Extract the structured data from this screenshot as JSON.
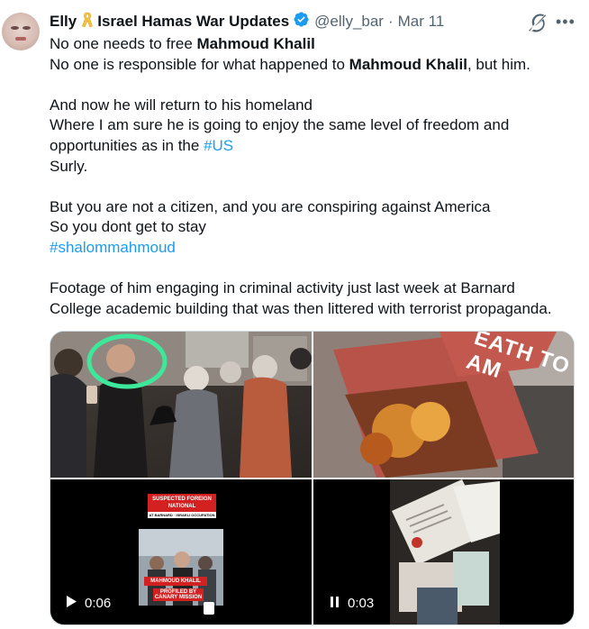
{
  "author": {
    "name": "Elly",
    "display_suffix": "Israel Hamas War Updates",
    "handle": "@elly_bar",
    "separator": "·",
    "date": "Mar 11"
  },
  "icons": {
    "ribbon": "yellow-ribbon-icon",
    "verified": "verified-badge-icon",
    "grok": "grok-icon",
    "more": "more-icon",
    "play": "play-icon",
    "pause": "pause-icon"
  },
  "colors": {
    "link": "#1d9bf0",
    "verified": "#1d9bf0",
    "ribbon": "#f4c542",
    "text": "#0f1419",
    "muted": "#536471"
  },
  "tweet": {
    "l1_pre": "No one needs to free ",
    "l1_bold": "Mahmoud Khalil",
    "l2_pre": "No one is responsible for what happened to ",
    "l2_bold": "Mahmoud Khalil",
    "l2_post": ", but him.",
    "l3": "And now he will return to his homeland",
    "l4": "Where I am sure he is going to enjoy the same level of freedom and",
    "l5_pre": "opportunities as in the ",
    "l5_tag": "#US",
    "l6": "Surly.",
    "l7": "But you are not a citizen, and you are conspiring against America",
    "l8": "So you dont get to stay",
    "l9_tag": "#shalommahmoud",
    "l10": "Footage of him engaging in criminal activity just last week at Barnard",
    "l11": "College academic building that was then littered with terrorist propaganda."
  },
  "media": {
    "video1": {
      "duration": "0:06",
      "banner_top": "SUSPECTED FOREIGN NATIONAL",
      "banner_sub": "AT BARNARD · ISRAELI OCCUPATION",
      "name_label": "MAHMOUD KHALIL",
      "profiled_label": "PROFILED BY CANARY MISSION"
    },
    "video2": {
      "duration": "0:03"
    },
    "image2_text": "EATH TO AM"
  }
}
